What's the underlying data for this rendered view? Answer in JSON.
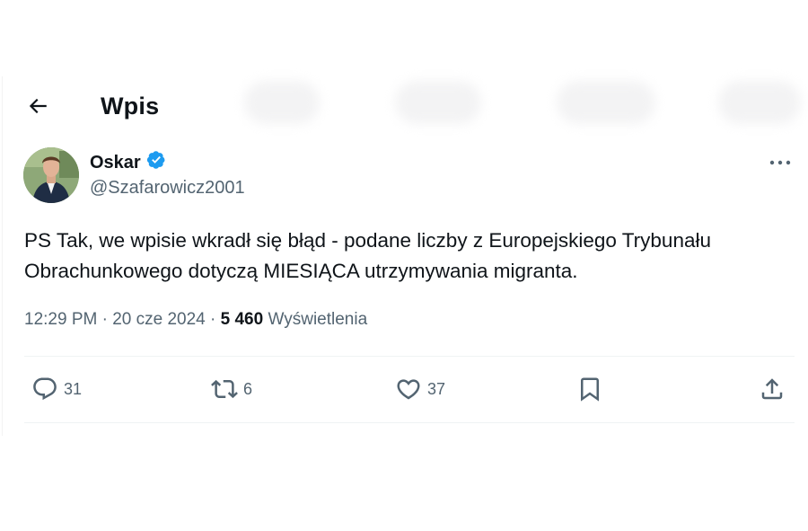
{
  "header": {
    "title": "Wpis",
    "back_icon": "arrow-left-icon"
  },
  "author": {
    "display_name": "Oskar",
    "handle": "@Szafarowicz2001",
    "verified_icon": "verified-badge-icon",
    "verified_color": "#1d9bf0"
  },
  "tweet": {
    "text": "PS Tak, we wpisie wkradł się błąd - podane liczby z Europejskiego Trybunału Obrachunkowego dotyczą MIESIĄCA utrzymywania migranta.",
    "time": "12:29 PM",
    "date": "20 cze 2024",
    "separator": "·",
    "views_count": "5 460",
    "views_label": "Wyświetlenia"
  },
  "actions": {
    "reply_count": "31",
    "retweet_count": "6",
    "like_count": "37"
  },
  "colors": {
    "text_primary": "#0f1419",
    "text_secondary": "#536471",
    "divider": "#eff3f4"
  }
}
